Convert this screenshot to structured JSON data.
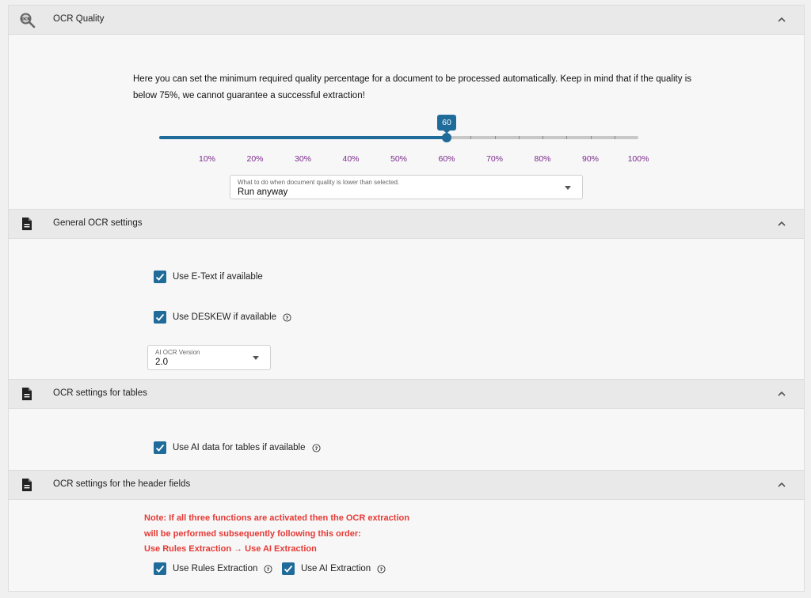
{
  "sections": {
    "ocr_quality": {
      "title": "OCR Quality",
      "intro": "Here you can set the minimum required quality percentage for a document to be processed automatically. Keep in mind that if the quality is below 75%, we cannot guarantee a successful extraction!",
      "slider": {
        "value": 60,
        "value_label": "60",
        "min": 0,
        "max": 100,
        "tick_labels": [
          "10%",
          "20%",
          "30%",
          "40%",
          "50%",
          "60%",
          "70%",
          "80%",
          "90%",
          "100%"
        ]
      },
      "low_quality_select": {
        "label": "What to do when document quality is lower than selected.",
        "value": "Run anyway"
      }
    },
    "general": {
      "title": "General OCR settings",
      "etext_label": "Use E-Text if available",
      "deskew_label": "Use DESKEW if available",
      "ai_version_select": {
        "label": "AI OCR Version",
        "value": "2.0"
      }
    },
    "tables": {
      "title": "OCR settings for tables",
      "ai_tables_label": "Use AI data for tables if available"
    },
    "header_fields": {
      "title": "OCR settings for the header fields",
      "note_lines": [
        "Note: If all three functions are activated then the OCR extraction",
        "will be performed subsequently following this order:",
        "Use Rules Extraction → Use AI Extraction"
      ],
      "rules_label": "Use Rules Extraction",
      "ai_label": "Use AI Extraction"
    }
  },
  "colors": {
    "accent": "#1f6b9a",
    "tick_label": "#7b2a8d",
    "note": "#e53935"
  },
  "icons": {
    "ocr_quality": "ocr-magnifier-icon",
    "document": "document-icon",
    "collapse": "chevron-up-icon",
    "help": "help-circle-icon",
    "check": "check-icon"
  }
}
